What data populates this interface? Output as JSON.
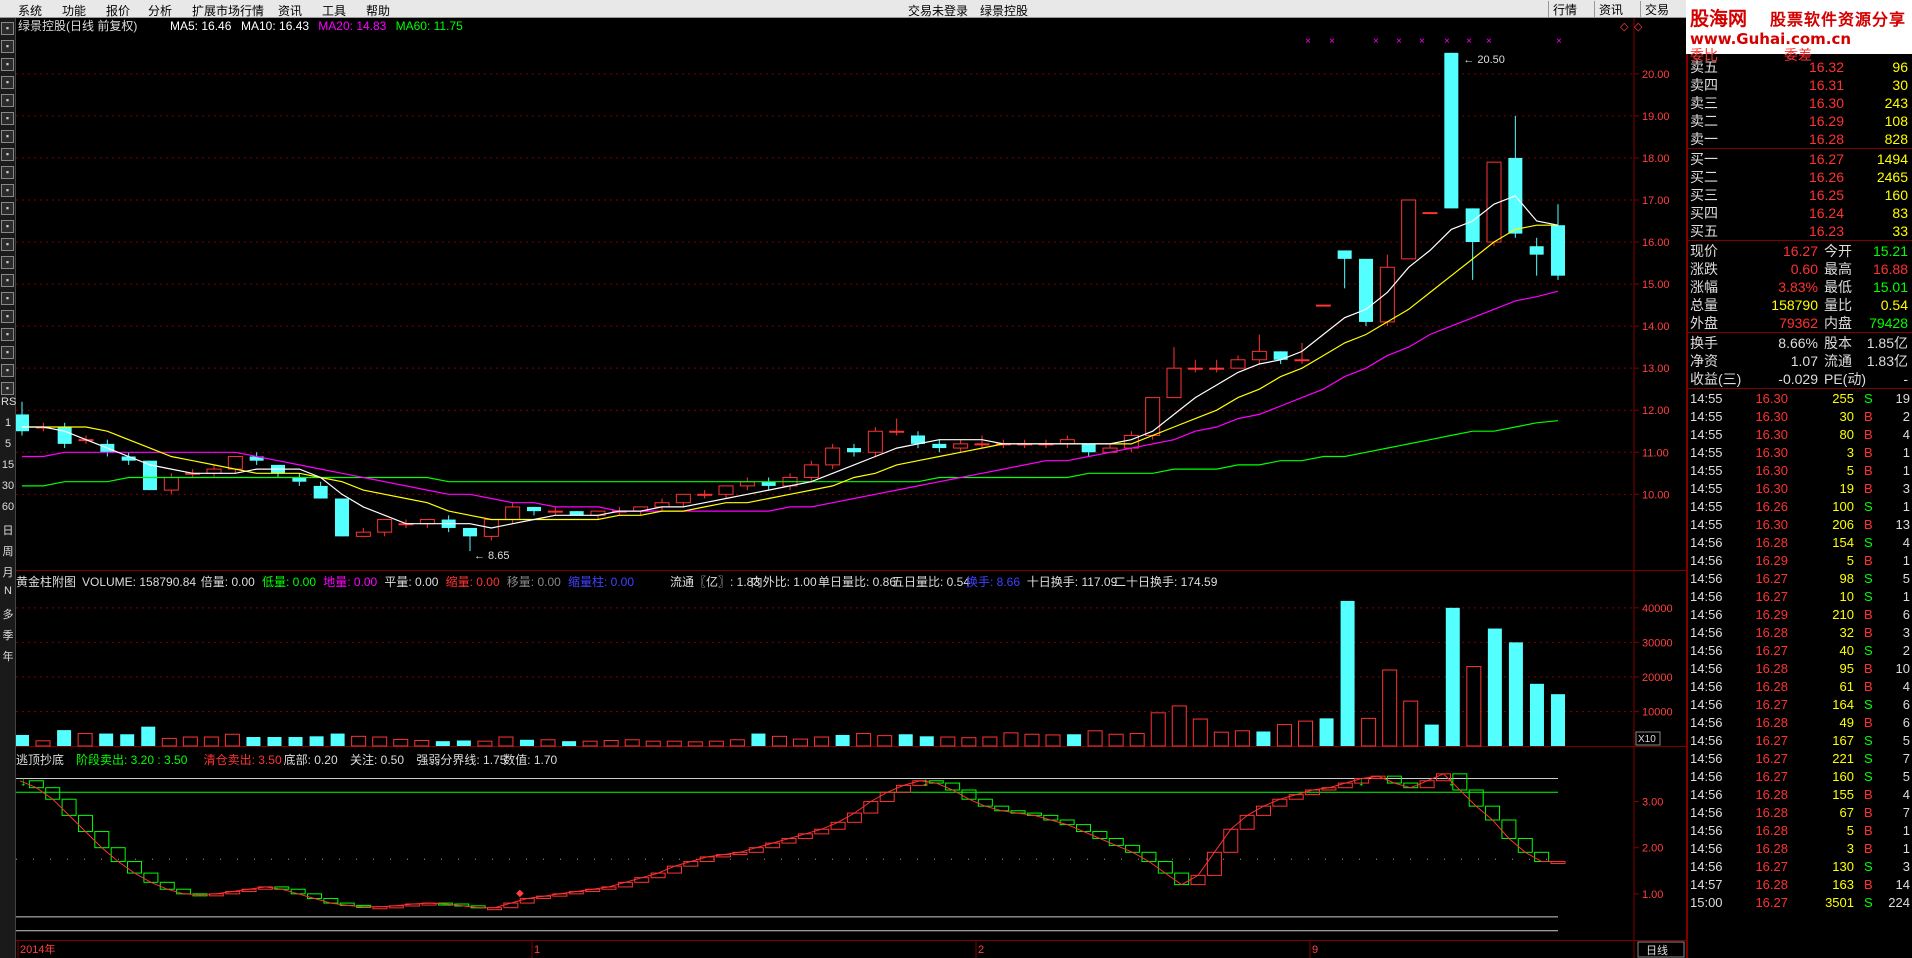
{
  "menubar": {
    "items": [
      "系统",
      "功能",
      "报价",
      "分析",
      "扩展市场行情",
      "资讯",
      "工具",
      "帮助"
    ],
    "center": [
      "交易未登录",
      "绿景控股"
    ],
    "right_tabs": [
      "行情",
      "资讯",
      "交易"
    ]
  },
  "logo": {
    "l1": "股海网",
    "l2": "股票软件资源分享",
    "l3": "www.Guhai.com.cn"
  },
  "colors": {
    "up": "#ff3232",
    "down": "#54ffff",
    "ma5": "#ffffff",
    "ma10": "#ffff00",
    "ma20": "#ff00ff",
    "ma60": "#00ff00",
    "grid": "#800000",
    "signal": "#00ff00"
  },
  "toolbar": {
    "icons": [
      "home-icon",
      "back-icon",
      "forward-icon",
      "chart-icon",
      "grid-icon",
      "list-icon",
      "bar-icon",
      "search-icon",
      "settings-icon",
      "zoom-icon",
      "report-icon",
      "window-icon",
      "tool-icon",
      "cross-icon",
      "arrow-icon",
      "pen-icon",
      "doc-icon",
      "box-icon",
      "print-icon",
      "calc-icon",
      "note-icon"
    ],
    "periods": [
      "RSI",
      "1",
      "5",
      "15",
      "30",
      "60",
      "日",
      "周",
      "月",
      "N",
      "多",
      "季",
      "年"
    ]
  },
  "main_panel": {
    "title": "绿景控股(日线 前复权)",
    "ma5": "MA5: 16.46",
    "ma10": "MA10: 16.43",
    "ma20": "MA20: 14.83",
    "ma60": "MA60: 11.75",
    "y_ticks": [
      "20.00",
      "19.00",
      "18.00",
      "17.00",
      "16.00",
      "15.00",
      "14.00",
      "13.00",
      "12.00",
      "11.00",
      "10.00"
    ],
    "high_label": "20.50",
    "low_label": "8.65"
  },
  "volume_panel": {
    "title": "黄金柱附图",
    "volume": "VOLUME: 158790.84",
    "beiliang": "倍量: 0.00",
    "diliang": "低量: 0.00",
    "diliang2": "地量: 0.00",
    "pingliang": "平量: 0.00",
    "suoliang": "缩量: 0.00",
    "yiliang": "移量: 0.00",
    "renzhuliang": "缩量柱: 0.00",
    "liutong": "流通〖亿〗: 1.83",
    "neiwai": "内外比: 1.00",
    "danri": "单日量比: 0.86",
    "wuri": "五日量比: 0.54",
    "huanshou": "换手: 8.66",
    "shiri": "十日换手: 117.09",
    "ershiri": "二十日换手: 174.59",
    "y_ticks": [
      "40000",
      "30000",
      "20000",
      "10000"
    ],
    "unit": "X10"
  },
  "indicator_panel": {
    "title": "逃顶抄底",
    "stage_sell": "阶段卖出: 3.20 : 3.50",
    "clear_sell": "清仓卖出: 3.50",
    "bottom": "底部: 0.20",
    "watch": "关注: 0.50",
    "strength": "强弱分界线: 1.75",
    "value": "数值: 1.70",
    "y_ticks": [
      "3.00",
      "2.00",
      "1.00"
    ]
  },
  "x_axis": {
    "labels": [
      "2014年",
      "1",
      "2",
      "9"
    ],
    "period": "日线"
  },
  "chart_data": {
    "type": "candlestick",
    "title": "绿景控股(日线 前复权)",
    "ylim": [
      8.2,
      20.9
    ],
    "candles": [
      [
        11.9,
        11.5,
        12.2,
        11.4
      ],
      [
        11.6,
        11.6,
        11.7,
        11.5
      ],
      [
        11.6,
        11.2,
        11.7,
        11.1
      ],
      [
        11.3,
        11.3,
        11.4,
        11.2
      ],
      [
        11.2,
        11.0,
        11.3,
        10.9
      ],
      [
        10.9,
        10.8,
        11.0,
        10.7
      ],
      [
        10.8,
        10.1,
        10.8,
        10.1
      ],
      [
        10.1,
        10.4,
        10.5,
        10.0
      ],
      [
        10.5,
        10.5,
        10.6,
        10.4
      ],
      [
        10.5,
        10.6,
        10.7,
        10.4
      ],
      [
        10.6,
        10.9,
        10.9,
        10.5
      ],
      [
        10.9,
        10.8,
        11.0,
        10.7
      ],
      [
        10.7,
        10.5,
        10.7,
        10.4
      ],
      [
        10.4,
        10.3,
        10.5,
        10.2
      ],
      [
        10.2,
        9.9,
        10.3,
        9.9
      ],
      [
        9.9,
        9.0,
        9.9,
        9.0
      ],
      [
        9.0,
        9.1,
        9.2,
        9.0
      ],
      [
        9.1,
        9.4,
        9.4,
        9.0
      ],
      [
        9.3,
        9.3,
        9.4,
        9.2
      ],
      [
        9.3,
        9.4,
        9.4,
        9.2
      ],
      [
        9.4,
        9.2,
        9.5,
        9.1
      ],
      [
        9.2,
        9.0,
        9.2,
        8.65
      ],
      [
        9.0,
        9.4,
        9.4,
        8.9
      ],
      [
        9.4,
        9.7,
        9.8,
        9.3
      ],
      [
        9.7,
        9.6,
        9.7,
        9.5
      ],
      [
        9.6,
        9.6,
        9.7,
        9.5
      ],
      [
        9.6,
        9.5,
        9.6,
        9.5
      ],
      [
        9.5,
        9.6,
        9.6,
        9.4
      ],
      [
        9.6,
        9.6,
        9.7,
        9.5
      ],
      [
        9.6,
        9.7,
        9.7,
        9.5
      ],
      [
        9.7,
        9.8,
        9.9,
        9.6
      ],
      [
        9.8,
        10.0,
        10.0,
        9.7
      ],
      [
        10.0,
        10.0,
        10.1,
        9.9
      ],
      [
        10.0,
        10.2,
        10.2,
        9.9
      ],
      [
        10.2,
        10.3,
        10.4,
        10.1
      ],
      [
        10.3,
        10.2,
        10.4,
        10.1
      ],
      [
        10.2,
        10.4,
        10.5,
        10.1
      ],
      [
        10.4,
        10.7,
        10.8,
        10.3
      ],
      [
        10.7,
        11.1,
        11.2,
        10.6
      ],
      [
        11.1,
        11.0,
        11.2,
        10.9
      ],
      [
        11.0,
        11.5,
        11.6,
        10.9
      ],
      [
        11.5,
        11.5,
        11.8,
        11.4
      ],
      [
        11.4,
        11.2,
        11.5,
        11.1
      ],
      [
        11.2,
        11.1,
        11.3,
        11.0
      ],
      [
        11.1,
        11.2,
        11.3,
        11.0
      ],
      [
        11.2,
        11.2,
        11.4,
        11.1
      ],
      [
        11.2,
        11.2,
        11.3,
        11.1
      ],
      [
        11.2,
        11.2,
        11.3,
        11.1
      ],
      [
        11.2,
        11.2,
        11.3,
        11.1
      ],
      [
        11.2,
        11.3,
        11.4,
        11.1
      ],
      [
        11.2,
        11.0,
        11.2,
        10.9
      ],
      [
        11.0,
        11.1,
        11.2,
        11.0
      ],
      [
        11.1,
        11.4,
        11.5,
        11.0
      ],
      [
        11.4,
        12.3,
        12.3,
        11.3
      ],
      [
        12.3,
        13.0,
        13.5,
        12.3
      ],
      [
        13.0,
        13.0,
        13.2,
        12.9
      ],
      [
        13.0,
        13.0,
        13.2,
        12.9
      ],
      [
        13.0,
        13.2,
        13.3,
        13.0
      ],
      [
        13.2,
        13.4,
        13.8,
        13.1
      ],
      [
        13.4,
        13.2,
        13.4,
        13.1
      ],
      [
        13.2,
        13.2,
        13.6,
        13.1
      ],
      [
        14.5,
        14.5,
        14.5,
        14.5
      ],
      [
        15.8,
        15.6,
        15.8,
        14.9
      ],
      [
        15.6,
        14.1,
        15.6,
        14.0
      ],
      [
        14.1,
        15.4,
        15.7,
        14.0
      ],
      [
        15.6,
        17.0,
        17.0,
        15.6
      ],
      [
        16.7,
        16.7,
        16.7,
        16.7
      ],
      [
        20.5,
        16.8,
        20.5,
        16.8
      ],
      [
        16.8,
        16.0,
        16.8,
        15.1
      ],
      [
        16.0,
        17.9,
        17.9,
        15.9
      ],
      [
        18.0,
        16.2,
        19.0,
        16.1
      ],
      [
        15.9,
        15.7,
        16.1,
        15.2
      ],
      [
        16.4,
        15.2,
        16.9,
        15.1
      ]
    ],
    "ma5": [
      11.6,
      11.6,
      11.5,
      11.3,
      11.1,
      10.9,
      10.7,
      10.6,
      10.5,
      10.5,
      10.5,
      10.6,
      10.6,
      10.6,
      10.4,
      10.0,
      9.7,
      9.5,
      9.3,
      9.3,
      9.3,
      9.3,
      9.2,
      9.3,
      9.4,
      9.5,
      9.5,
      9.5,
      9.6,
      9.6,
      9.7,
      9.7,
      9.8,
      9.9,
      10.0,
      10.1,
      10.2,
      10.3,
      10.5,
      10.7,
      10.9,
      11.1,
      11.2,
      11.3,
      11.3,
      11.3,
      11.2,
      11.2,
      11.2,
      11.2,
      11.2,
      11.2,
      11.3,
      11.5,
      11.9,
      12.3,
      12.6,
      12.9,
      13.1,
      13.2,
      13.4,
      13.8,
      14.2,
      14.4,
      14.8,
      15.4,
      15.8,
      16.3,
      16.5,
      16.9,
      17.1,
      16.5,
      16.4
    ],
    "ma10": [
      11.6,
      11.6,
      11.6,
      11.6,
      11.5,
      11.3,
      11.1,
      10.9,
      10.8,
      10.7,
      10.6,
      10.5,
      10.5,
      10.5,
      10.4,
      10.3,
      10.1,
      10.0,
      9.9,
      9.8,
      9.6,
      9.5,
      9.4,
      9.4,
      9.4,
      9.4,
      9.4,
      9.4,
      9.5,
      9.5,
      9.6,
      9.6,
      9.7,
      9.8,
      9.8,
      9.9,
      10.0,
      10.1,
      10.2,
      10.4,
      10.5,
      10.7,
      10.8,
      10.9,
      11.0,
      11.1,
      11.2,
      11.2,
      11.2,
      11.2,
      11.2,
      11.2,
      11.2,
      11.4,
      11.6,
      11.8,
      12.0,
      12.3,
      12.5,
      12.8,
      13.0,
      13.3,
      13.6,
      13.8,
      14.1,
      14.4,
      14.8,
      15.2,
      15.6,
      16.0,
      16.3,
      16.4,
      16.4
    ],
    "ma20": [
      10.9,
      10.9,
      11.0,
      11.0,
      11.0,
      11.0,
      11.0,
      11.0,
      11.0,
      11.0,
      11.0,
      10.9,
      10.8,
      10.7,
      10.6,
      10.5,
      10.4,
      10.3,
      10.2,
      10.1,
      10.0,
      10.0,
      9.9,
      9.8,
      9.8,
      9.7,
      9.7,
      9.7,
      9.6,
      9.6,
      9.6,
      9.6,
      9.6,
      9.6,
      9.6,
      9.6,
      9.7,
      9.7,
      9.8,
      9.9,
      10.0,
      10.1,
      10.2,
      10.3,
      10.4,
      10.5,
      10.6,
      10.7,
      10.8,
      10.8,
      10.9,
      11.0,
      11.1,
      11.2,
      11.3,
      11.5,
      11.6,
      11.8,
      11.9,
      12.1,
      12.3,
      12.5,
      12.8,
      13.0,
      13.3,
      13.5,
      13.8,
      14.0,
      14.2,
      14.4,
      14.6,
      14.7,
      14.83
    ],
    "ma60": [
      10.2,
      10.2,
      10.3,
      10.3,
      10.3,
      10.4,
      10.4,
      10.4,
      10.4,
      10.4,
      10.4,
      10.4,
      10.4,
      10.4,
      10.4,
      10.4,
      10.4,
      10.4,
      10.4,
      10.4,
      10.3,
      10.3,
      10.3,
      10.3,
      10.3,
      10.3,
      10.3,
      10.3,
      10.3,
      10.3,
      10.3,
      10.3,
      10.3,
      10.3,
      10.3,
      10.3,
      10.3,
      10.3,
      10.3,
      10.3,
      10.3,
      10.3,
      10.3,
      10.4,
      10.4,
      10.4,
      10.4,
      10.4,
      10.4,
      10.4,
      10.5,
      10.5,
      10.5,
      10.5,
      10.6,
      10.6,
      10.6,
      10.7,
      10.7,
      10.8,
      10.8,
      10.9,
      10.9,
      11.0,
      11.1,
      11.2,
      11.3,
      11.4,
      11.5,
      11.5,
      11.6,
      11.7,
      11.75
    ],
    "volume": [
      3200,
      1500,
      4600,
      3600,
      3600,
      3400,
      5600,
      2200,
      2600,
      2600,
      3400,
      2600,
      2600,
      2600,
      2800,
      3600,
      2800,
      2600,
      1900,
      1600,
      1400,
      1600,
      1400,
      2600,
      1800,
      1800,
      1400,
      1400,
      1600,
      1800,
      1400,
      1400,
      1200,
      1400,
      1800,
      3600,
      2800,
      2000,
      2600,
      3200,
      3600,
      3000,
      3400,
      2800,
      2600,
      2400,
      2600,
      3800,
      3400,
      3200,
      3400,
      4400,
      3400,
      3600,
      9600,
      11600,
      7800,
      4000,
      4400,
      4200,
      6200,
      7200,
      8000,
      42000,
      8000,
      22000,
      13000,
      6200,
      40000,
      23000,
      34000,
      30000,
      18000,
      15000
    ],
    "indicator": [
      3.45,
      3.3,
      3.05,
      2.7,
      2.35,
      2.0,
      1.7,
      1.45,
      1.25,
      1.1,
      1.0,
      0.98,
      1.0,
      1.05,
      1.1,
      1.15,
      1.1,
      1.0,
      0.9,
      0.8,
      0.75,
      0.72,
      0.72,
      0.74,
      0.78,
      0.8,
      0.78,
      0.74,
      0.7,
      0.7,
      0.8,
      0.9,
      0.95,
      1.0,
      1.05,
      1.1,
      1.15,
      1.25,
      1.35,
      1.45,
      1.6,
      1.7,
      1.8,
      1.85,
      1.9,
      2.0,
      2.1,
      2.2,
      2.3,
      2.4,
      2.55,
      2.75,
      3.0,
      3.2,
      3.35,
      3.45,
      3.4,
      3.25,
      3.05,
      2.9,
      2.8,
      2.75,
      2.7,
      2.6,
      2.5,
      2.35,
      2.2,
      2.05,
      1.9,
      1.7,
      1.45,
      1.2,
      1.4,
      1.9,
      2.4,
      2.7,
      2.9,
      3.05,
      3.15,
      3.25,
      3.3,
      3.4,
      3.5,
      3.55,
      3.4,
      3.3,
      3.45,
      3.6,
      3.25,
      2.9,
      2.6,
      2.2,
      1.9,
      1.7,
      1.7
    ],
    "stage_sell": 3.2,
    "clear_sell": 3.5,
    "bottom": 0.2,
    "watch": 0.5,
    "strength": 1.75
  },
  "quote": {
    "header": [
      "委比",
      "委差"
    ],
    "asks": [
      {
        "label": "卖五",
        "price": "16.32",
        "vol": "96"
      },
      {
        "label": "卖四",
        "price": "16.31",
        "vol": "30"
      },
      {
        "label": "卖三",
        "price": "16.30",
        "vol": "243"
      },
      {
        "label": "卖二",
        "price": "16.29",
        "vol": "108"
      },
      {
        "label": "卖一",
        "price": "16.28",
        "vol": "828"
      }
    ],
    "bids": [
      {
        "label": "买一",
        "price": "16.27",
        "vol": "1494"
      },
      {
        "label": "买二",
        "price": "16.26",
        "vol": "2465"
      },
      {
        "label": "买三",
        "price": "16.25",
        "vol": "160"
      },
      {
        "label": "买四",
        "price": "16.24",
        "vol": "83"
      },
      {
        "label": "买五",
        "price": "16.23",
        "vol": "33"
      }
    ],
    "stats": [
      {
        "l1": "现价",
        "v1": "16.27",
        "l2": "今开",
        "v2": "15.21",
        "c1": "#ff3232",
        "c2": "#00ff00"
      },
      {
        "l1": "涨跌",
        "v1": "0.60",
        "l2": "最高",
        "v2": "16.88",
        "c1": "#ff3232",
        "c2": "#ff3232"
      },
      {
        "l1": "涨幅",
        "v1": "3.83%",
        "l2": "最低",
        "v2": "15.01",
        "c1": "#ff3232",
        "c2": "#00ff00"
      },
      {
        "l1": "总量",
        "v1": "158790",
        "l2": "量比",
        "v2": "0.54",
        "c1": "#ffff00",
        "c2": "#ffff00"
      },
      {
        "l1": "外盘",
        "v1": "79362",
        "l2": "内盘",
        "v2": "79428",
        "c1": "#ff3232",
        "c2": "#00ff00"
      }
    ],
    "extra": [
      {
        "l1": "换手",
        "v1": "8.66%",
        "l2": "股本",
        "v2": "1.85亿"
      },
      {
        "l1": "净资",
        "v1": "1.07",
        "l2": "流通",
        "v2": "1.83亿"
      },
      {
        "l1": "收益(三)",
        "v1": "-0.029",
        "l2": "PE(动)",
        "v2": "-"
      }
    ],
    "ticks": [
      {
        "t": "14:55",
        "p": "16.30",
        "v": "255",
        "d": "S",
        "n": "19"
      },
      {
        "t": "14:55",
        "p": "16.30",
        "v": "30",
        "d": "B",
        "n": "2"
      },
      {
        "t": "14:55",
        "p": "16.30",
        "v": "80",
        "d": "B",
        "n": "4"
      },
      {
        "t": "14:55",
        "p": "16.30",
        "v": "3",
        "d": "B",
        "n": "1"
      },
      {
        "t": "14:55",
        "p": "16.30",
        "v": "5",
        "d": "B",
        "n": "1"
      },
      {
        "t": "14:55",
        "p": "16.30",
        "v": "19",
        "d": "B",
        "n": "3"
      },
      {
        "t": "14:55",
        "p": "16.26",
        "v": "100",
        "d": "S",
        "n": "1"
      },
      {
        "t": "14:55",
        "p": "16.30",
        "v": "206",
        "d": "B",
        "n": "13"
      },
      {
        "t": "14:56",
        "p": "16.28",
        "v": "154",
        "d": "S",
        "n": "4"
      },
      {
        "t": "14:56",
        "p": "16.29",
        "v": "5",
        "d": "B",
        "n": "1"
      },
      {
        "t": "14:56",
        "p": "16.27",
        "v": "98",
        "d": "S",
        "n": "5"
      },
      {
        "t": "14:56",
        "p": "16.27",
        "v": "10",
        "d": "S",
        "n": "1"
      },
      {
        "t": "14:56",
        "p": "16.29",
        "v": "210",
        "d": "B",
        "n": "6"
      },
      {
        "t": "14:56",
        "p": "16.28",
        "v": "32",
        "d": "B",
        "n": "3"
      },
      {
        "t": "14:56",
        "p": "16.27",
        "v": "40",
        "d": "S",
        "n": "2"
      },
      {
        "t": "14:56",
        "p": "16.28",
        "v": "95",
        "d": "B",
        "n": "10"
      },
      {
        "t": "14:56",
        "p": "16.28",
        "v": "61",
        "d": "B",
        "n": "4"
      },
      {
        "t": "14:56",
        "p": "16.27",
        "v": "164",
        "d": "S",
        "n": "6"
      },
      {
        "t": "14:56",
        "p": "16.28",
        "v": "49",
        "d": "B",
        "n": "6"
      },
      {
        "t": "14:56",
        "p": "16.27",
        "v": "167",
        "d": "S",
        "n": "5"
      },
      {
        "t": "14:56",
        "p": "16.27",
        "v": "221",
        "d": "S",
        "n": "7"
      },
      {
        "t": "14:56",
        "p": "16.27",
        "v": "160",
        "d": "S",
        "n": "5"
      },
      {
        "t": "14:56",
        "p": "16.28",
        "v": "155",
        "d": "B",
        "n": "4"
      },
      {
        "t": "14:56",
        "p": "16.28",
        "v": "67",
        "d": "B",
        "n": "7"
      },
      {
        "t": "14:56",
        "p": "16.28",
        "v": "5",
        "d": "B",
        "n": "1"
      },
      {
        "t": "14:56",
        "p": "16.28",
        "v": "3",
        "d": "B",
        "n": "1"
      },
      {
        "t": "14:56",
        "p": "16.27",
        "v": "130",
        "d": "S",
        "n": "3"
      },
      {
        "t": "14:57",
        "p": "16.28",
        "v": "163",
        "d": "B",
        "n": "14"
      },
      {
        "t": "15:00",
        "p": "16.27",
        "v": "3501",
        "d": "S",
        "n": "224"
      }
    ]
  }
}
